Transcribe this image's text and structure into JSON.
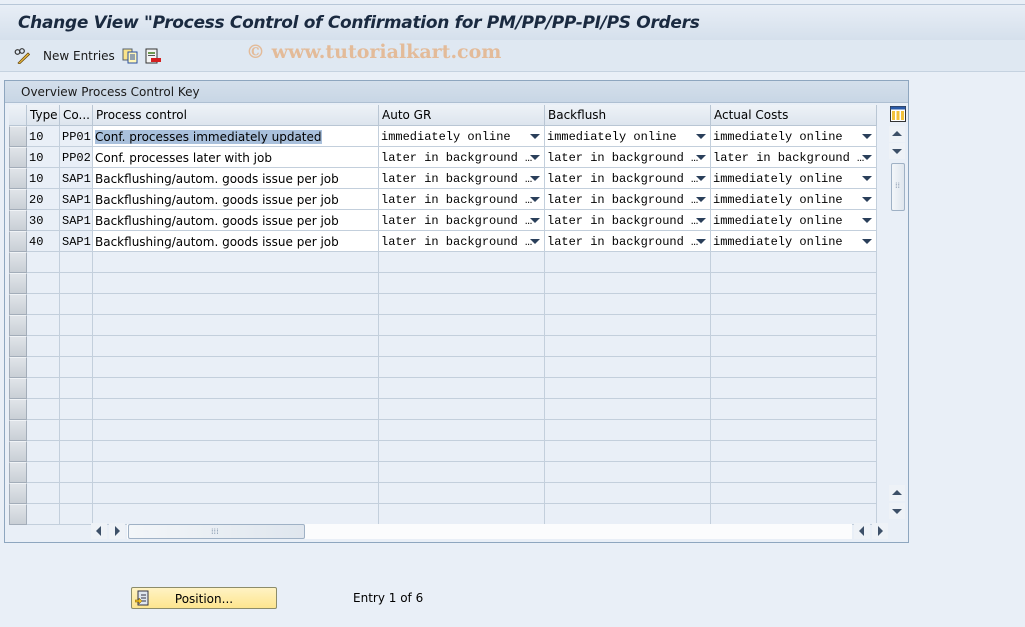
{
  "window": {
    "title": "Change View \"Process Control of Confirmation for PM/PP/PP-PI/PS Orders",
    "watermark": "© www.tutorialkart.com"
  },
  "toolbar": {
    "icons": [
      "edit-glasses-icon",
      "copy-icon",
      "delete-icon"
    ],
    "new_entries_label": "New Entries"
  },
  "panel": {
    "title": "Overview Process Control Key"
  },
  "table": {
    "columns": [
      "Type",
      "Co...",
      "Process control",
      "Auto GR",
      "Backflush",
      "Actual Costs"
    ],
    "rows": [
      {
        "type": "10",
        "co": "PP01",
        "process_control": "Conf. processes immediately updated",
        "auto_gr": "immediately online",
        "backflush": "immediately online",
        "actual_costs": "immediately online"
      },
      {
        "type": "10",
        "co": "PP02",
        "process_control": "Conf. processes later with job",
        "auto_gr": "later in background …",
        "backflush": "later in background …",
        "actual_costs": "later in background …"
      },
      {
        "type": "10",
        "co": "SAP1",
        "process_control": "Backflushing/autom. goods issue per job",
        "auto_gr": "later in background …",
        "backflush": "later in background …",
        "actual_costs": "immediately online"
      },
      {
        "type": "20",
        "co": "SAP1",
        "process_control": "Backflushing/autom. goods issue per job",
        "auto_gr": "later in background …",
        "backflush": "later in background …",
        "actual_costs": "immediately online"
      },
      {
        "type": "30",
        "co": "SAP1",
        "process_control": "Backflushing/autom. goods issue per job",
        "auto_gr": "later in background …",
        "backflush": "later in background …",
        "actual_costs": "immediately online"
      },
      {
        "type": "40",
        "co": "SAP1",
        "process_control": "Backflushing/autom. goods issue per job",
        "auto_gr": "later in background …",
        "backflush": "later in background …",
        "actual_costs": "immediately online"
      }
    ],
    "empty_rows": 13,
    "selected_cell": "row 1 process_control"
  },
  "footer": {
    "position_button_label": "Position...",
    "entry_text": "Entry 1 of 6"
  }
}
